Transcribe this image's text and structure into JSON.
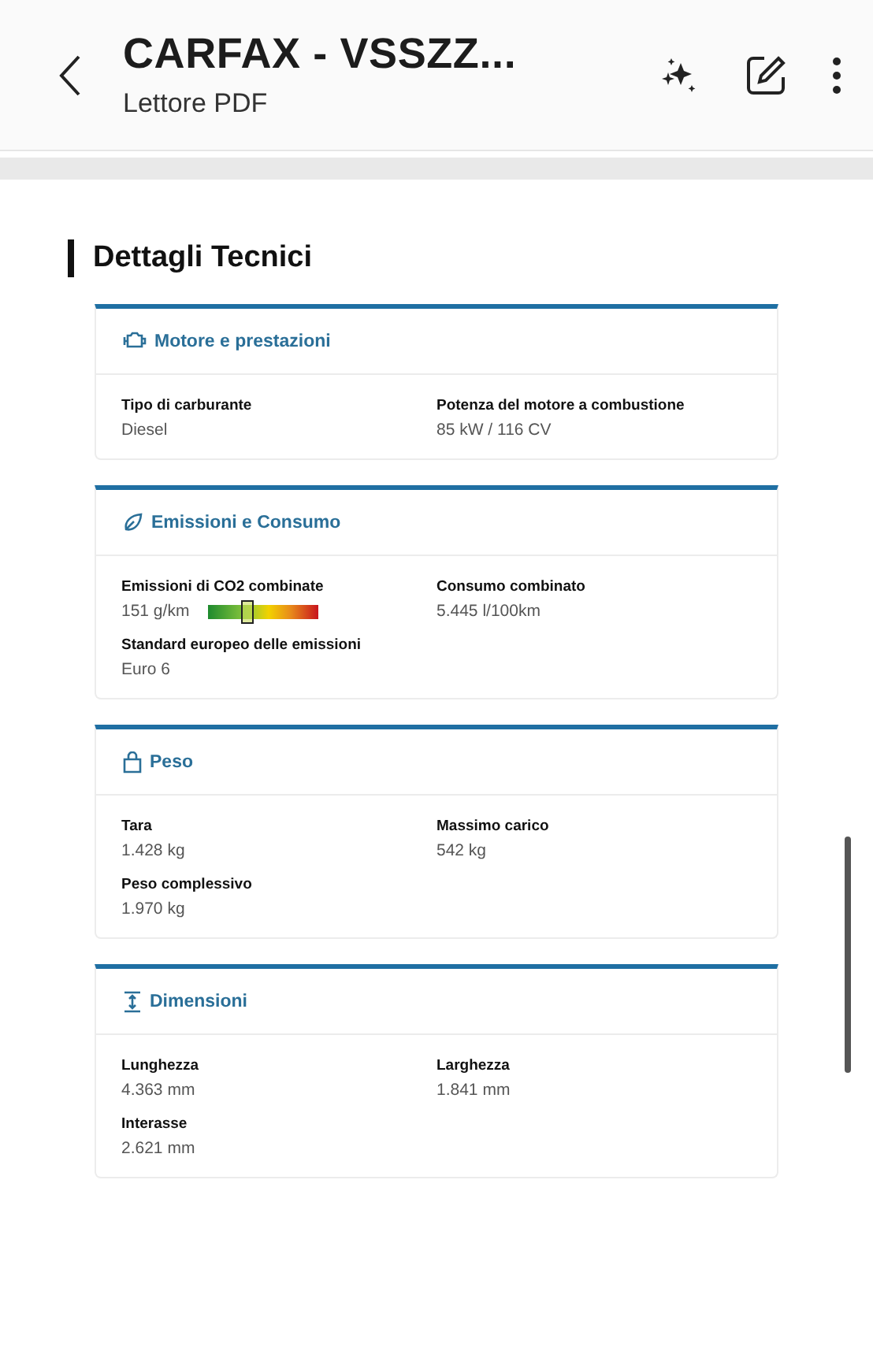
{
  "app_bar": {
    "title": "CARFAX - VSSZZ...",
    "subtitle": "Lettore PDF"
  },
  "section_title": "Dettagli Tecnici",
  "cards": [
    {
      "title": "Motore e prestazioni",
      "fields": [
        {
          "kind": "text",
          "label": "Tipo di carburante",
          "value": "Diesel"
        },
        {
          "kind": "text",
          "label": "Potenza del motore a combustione",
          "value": "85 kW / 116 CV"
        }
      ]
    },
    {
      "title": "Emissioni e Consumo",
      "fields": [
        {
          "kind": "meter",
          "label": "Emissioni di CO2 combinate",
          "value": "151 g/km",
          "level": 0.35
        },
        {
          "kind": "text",
          "label": "Consumo combinato",
          "value": "5.445 l/100km"
        },
        {
          "kind": "text",
          "label": "Standard europeo delle emissioni",
          "value": "Euro 6"
        }
      ]
    },
    {
      "title": "Peso",
      "fields": [
        {
          "kind": "text",
          "label": "Tara",
          "value": "1.428 kg"
        },
        {
          "kind": "text",
          "label": "Massimo carico",
          "value": "542 kg"
        },
        {
          "kind": "text",
          "label": "Peso complessivo",
          "value": "1.970 kg"
        }
      ]
    },
    {
      "title": "Dimensioni",
      "fields": [
        {
          "kind": "text",
          "label": "Lunghezza",
          "value": "4.363 mm"
        },
        {
          "kind": "text",
          "label": "Larghezza",
          "value": "1.841 mm"
        },
        {
          "kind": "text",
          "label": "Interasse",
          "value": "2.621 mm"
        }
      ]
    }
  ]
}
